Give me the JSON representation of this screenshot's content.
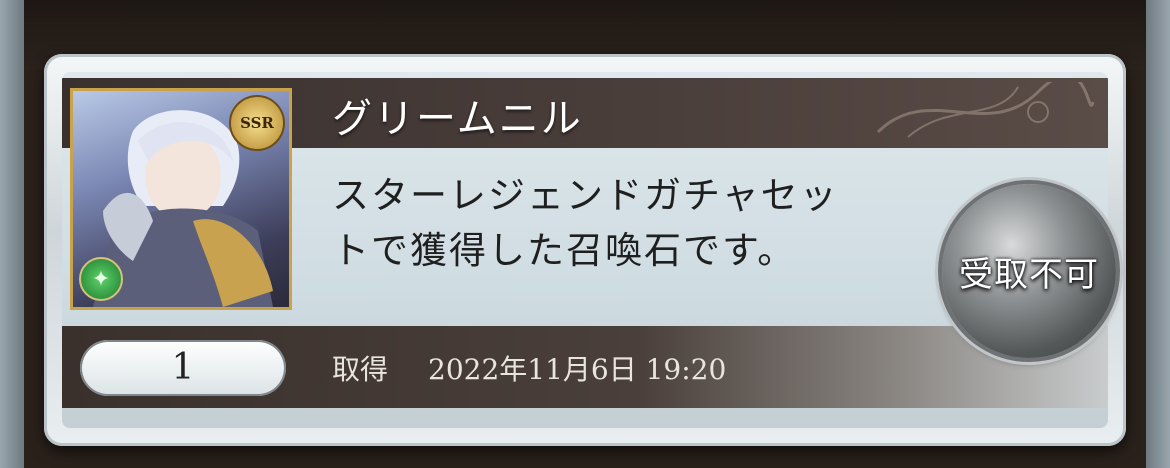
{
  "item": {
    "name": "グリームニル",
    "description": "スターレジェンドガチャセットで獲得した召喚石です。",
    "rarity": "SSR",
    "element_icon": "wind-element-icon",
    "quantity": "1",
    "acquired_label": "取得",
    "acquired_datetime": "2022年11月6日 19:20"
  },
  "claim_button": {
    "label": "受取不可",
    "enabled": false
  },
  "colors": {
    "name_bar": "#3a312f",
    "frame_gold": "#caa24a",
    "button_silver": "#8f9294"
  }
}
